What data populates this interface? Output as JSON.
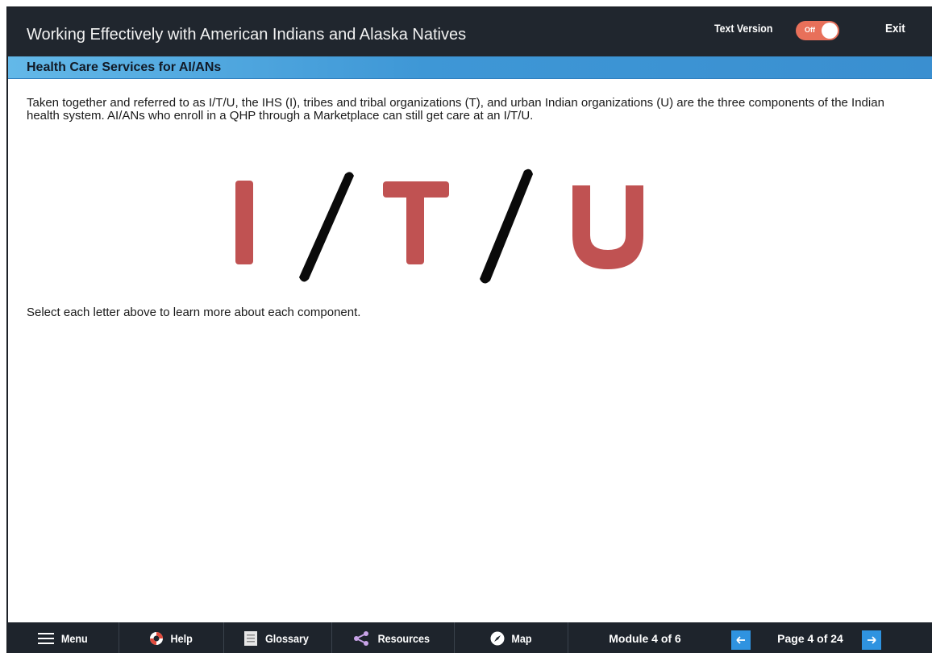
{
  "header": {
    "app_title": "Working Effectively with American Indians and Alaska Natives",
    "text_version_label": "Text Version",
    "toggle_state": "Off",
    "exit_label": "Exit"
  },
  "section": {
    "title": "Health Care Services for AI/ANs"
  },
  "content": {
    "intro": "Taken together and referred to as I/T/U, the IHS (I), tribes and tribal organizations (T), and urban Indian organizations (U) are the three components of the Indian health system. AI/ANs who enroll in a QHP through a Marketplace can still get care at an I/T/U.",
    "letters": [
      "I",
      "T",
      "U"
    ],
    "instruction": "Select each letter above to learn more about each component."
  },
  "footer": {
    "menu_label": "Menu",
    "help_label": "Help",
    "glossary_label": "Glossary",
    "resources_label": "Resources",
    "map_label": "Map",
    "module_status": "Module 4 of 6",
    "page_status": "Page 4 of 24",
    "prev_icon": "arrow-left-icon",
    "next_icon": "arrow-right-icon"
  },
  "colors": {
    "topbar": "#20262e",
    "section_bar": "#3e97d6",
    "letter_red": "#c05252",
    "slash_black": "#0a0a0a",
    "toggle_off": "#e8705a",
    "nav_arrow": "#2f93e0"
  }
}
